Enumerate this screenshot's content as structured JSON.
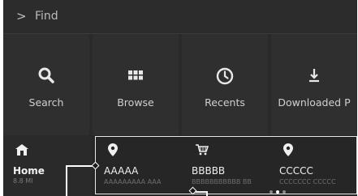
{
  "header": {
    "chevron": ">",
    "title": "Find"
  },
  "tiles": [
    {
      "label": "Search",
      "icon": "search-icon"
    },
    {
      "label": "Browse",
      "icon": "grid-icon"
    },
    {
      "label": "Recents",
      "icon": "clock-icon"
    },
    {
      "label": "Downloaded P",
      "icon": "download-icon"
    }
  ],
  "home": {
    "label": "Home",
    "distance": "8.8 MI",
    "icon": "home-icon"
  },
  "cards": [
    {
      "name": "AAAAA",
      "sub": "AAAAAAAAA AAA",
      "icon": "pin-icon"
    },
    {
      "name": "BBBBB",
      "sub": "BBBBBBBBBBB BB",
      "icon": "cart-icon"
    },
    {
      "name": "CCCCC",
      "sub": "CCCCCCC CCCCC",
      "icon": "pin-icon"
    }
  ],
  "pagination": {
    "pages": 3,
    "active": 1
  },
  "colors": {
    "background": "#2a2a2a",
    "text": "#cfcfcf",
    "highlight": "#ffffff"
  }
}
